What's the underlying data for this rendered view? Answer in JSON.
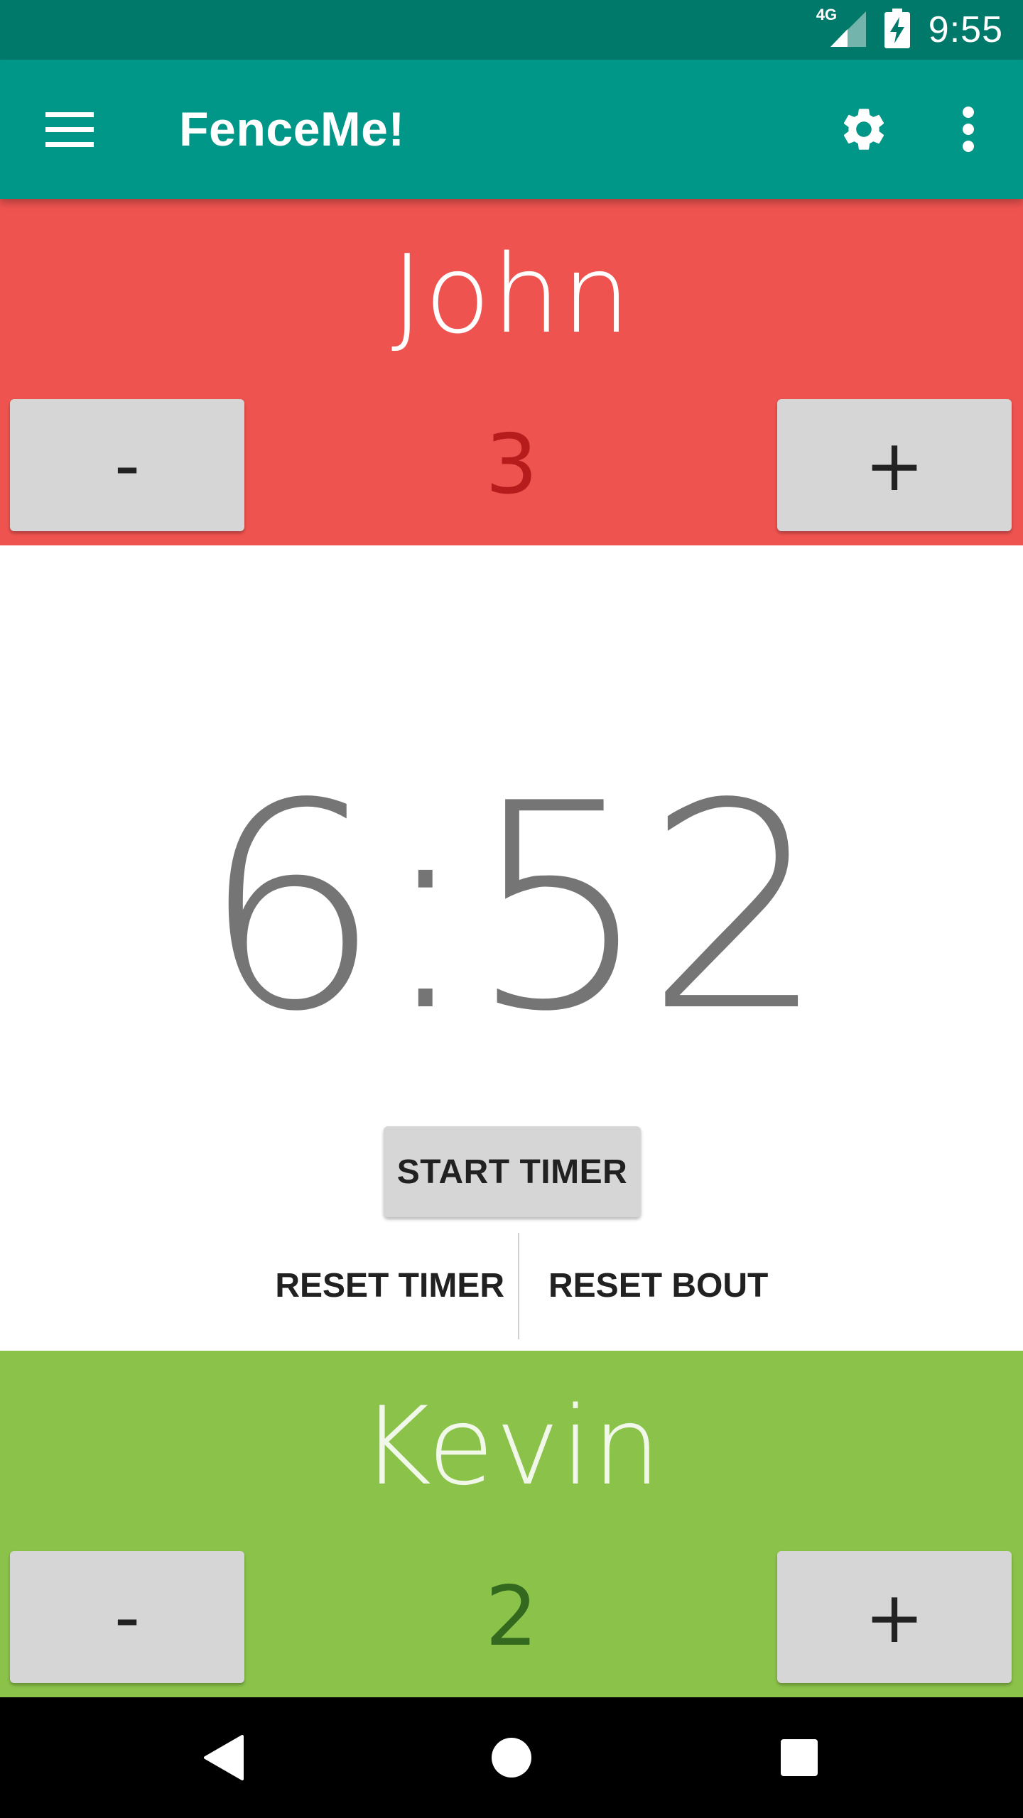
{
  "status_bar": {
    "network": "4G",
    "time": "9:55"
  },
  "app_bar": {
    "title": "FenceMe!",
    "icons": {
      "menu": "menu-icon",
      "settings": "gear-icon",
      "overflow": "more-vertical-icon"
    }
  },
  "players": {
    "top": {
      "name": "John",
      "score": "3",
      "minus_label": "-",
      "plus_label": "+",
      "panel_color": "#ef5350"
    },
    "bottom": {
      "name": "Kevin",
      "score": "2",
      "minus_label": "-",
      "plus_label": "+",
      "panel_color": "#8bc34a"
    }
  },
  "timer": {
    "display": "6:52",
    "start_label": "START TIMER",
    "reset_timer_label": "RESET TIMER",
    "reset_bout_label": "RESET BOUT"
  },
  "nav_bar": {
    "icons": {
      "back": "back-triangle-icon",
      "home": "home-circle-icon",
      "recents": "recents-square-icon"
    }
  },
  "colors": {
    "status_bar": "#00796b",
    "app_bar": "#009688",
    "button_gray": "#d6d6d6",
    "timer_text": "#757575"
  }
}
